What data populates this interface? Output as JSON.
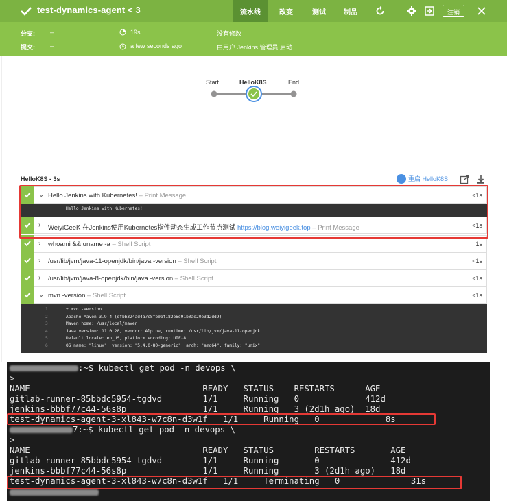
{
  "header": {
    "title": "test-dynamics-agent",
    "build": "< 3",
    "tabs": [
      "流水线",
      "改变",
      "测试",
      "制品"
    ],
    "logout": "注销"
  },
  "info": {
    "branch_label": "分支:",
    "branch_value": "–",
    "commit_label": "提交:",
    "commit_value": "–",
    "duration": "19s",
    "time_ago": "a few seconds ago",
    "changes": "没有修改",
    "cause": "由用户 Jenkins 管理员 启动"
  },
  "graph": {
    "stages": [
      "Start",
      "HelloK8S",
      "End"
    ]
  },
  "stage_panel": {
    "title": "HelloK8S - 3s",
    "restart": "重启 HelloK8S"
  },
  "steps": [
    {
      "text": "Hello Jenkins with Kubernetes!",
      "kind": "– Print Message",
      "dur": "<1s",
      "expanded": true
    },
    {
      "text": "WeiyiGeeK 在Jenkins使用Kubernetes指件动态生成工作节点测试 ",
      "link": "https://blog.weiyigeek.top",
      "kind": " – Print Message",
      "dur": "<1s"
    },
    {
      "text": "whoami && uname -a",
      "kind": " – Shell Script",
      "dur": "1s"
    },
    {
      "text": "/usr/lib/jvm/java-11-openjdk/bin/java -version",
      "kind": " – Shell Script",
      "dur": "<1s"
    },
    {
      "text": "/usr/lib/jvm/java-8-openjdk/bin/java -version",
      "kind": " – Shell Script",
      "dur": "<1s"
    },
    {
      "text": "mvn -version",
      "kind": " – Shell Script",
      "dur": "<1s",
      "expanded": true
    }
  ],
  "log1": [
    "Hello Jenkins with Kubernetes!"
  ],
  "log2": [
    {
      "n": "1",
      "t": "+ mvn -version"
    },
    {
      "n": "2",
      "t": "Apache Maven 3.9.4 (dfbb324ad4a7c8fb0bf182e6d91b0ae20e3d2dd9)"
    },
    {
      "n": "3",
      "t": "Maven home: /usr/local/maven"
    },
    {
      "n": "4",
      "t": "Java version: 11.0.20, vendor: Alpine, runtime: /usr/lib/jvm/java-11-openjdk"
    },
    {
      "n": "5",
      "t": "Default locale: en_US, platform encoding: UTF-8"
    },
    {
      "n": "6",
      "t": "OS name: \"linux\", version: \"5.4.0-80-generic\", arch: \"amd64\", family: \"unix\""
    }
  ],
  "terminal": {
    "cmd1": ":~$ kubectl get pod -n devops \\",
    "cont": ">",
    "t1": [
      "NAME                                  READY   STATUS    RESTARTS      AGE",
      "gitlab-runner-85bbdc5954-tgdvd        1/1     Running   0             412d",
      "jenkins-bbbf77c44-56s8p               1/1     Running   3 (2d1h ago)  18d",
      "test-dynamics-agent-3-xl843-w7c8n-d3w1f   1/1     Running   0             8s"
    ],
    "cmd2": "7:~$ kubectl get pod -n devops \\",
    "t2": [
      "NAME                                  READY   STATUS        RESTARTS       AGE",
      "gitlab-runner-85bbdc5954-tgdvd        1/1     Running       0              412d",
      "jenkins-bbbf77c44-56s8p               1/1     Running       3 (2d1h ago)   18d",
      "test-dynamics-agent-3-xl843-w7c8n-d3w1f   1/1     Terminating   0              31s"
    ]
  },
  "colors": {
    "green": "#7cb342",
    "red": "#e53935"
  }
}
